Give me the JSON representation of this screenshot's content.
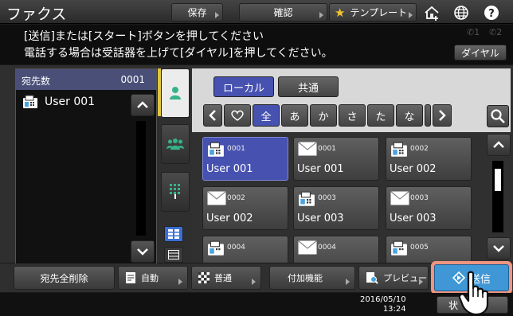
{
  "header": {
    "title": "ファクス",
    "save_label": "保存",
    "confirm_label": "確認",
    "template_label": "テンプレート"
  },
  "message": {
    "line1": "[送信]または[スタート]ボタンを押してください",
    "line2": "電話する場合は受話器を上げて[ダイヤル]を押してください。",
    "line_indicator_1": "1",
    "line_indicator_2": "2",
    "dial_label": "ダイヤル"
  },
  "recipients": {
    "header_label": "宛先数",
    "count": "0001",
    "items": [
      {
        "name": "User 001"
      }
    ]
  },
  "addressbook": {
    "local_label": "ローカル",
    "shared_label": "共通",
    "kana_tabs": [
      "全",
      "あ",
      "か",
      "さ",
      "た",
      "な"
    ],
    "active_kana": "全",
    "cards": [
      {
        "num": "0001",
        "name": "User 001",
        "type": "fax-icon",
        "selected": true
      },
      {
        "num": "0001",
        "name": "User 001",
        "type": "mail-icon",
        "selected": false
      },
      {
        "num": "0002",
        "name": "User 002",
        "type": "fax-icon",
        "selected": false
      },
      {
        "num": "0002",
        "name": "User 002",
        "type": "mail-icon",
        "selected": false
      },
      {
        "num": "0003",
        "name": "User 003",
        "type": "fax-icon",
        "selected": false
      },
      {
        "num": "0003",
        "name": "User 003",
        "type": "mail-icon",
        "selected": false
      },
      {
        "num": "0004",
        "name": "",
        "type": "fax-icon",
        "selected": false
      },
      {
        "num": "0004",
        "name": "",
        "type": "mail-icon",
        "selected": false
      },
      {
        "num": "0005",
        "name": "",
        "type": "fax-icon",
        "selected": false
      }
    ]
  },
  "functions": {
    "delete_all_label": "宛先全削除",
    "auto_label": "自動",
    "normal_label": "普通",
    "extra_label": "付加機能",
    "preview_label": "プレビュー",
    "send_label": "送信"
  },
  "status": {
    "date": "2016/05/10",
    "time": "13:24",
    "status_label": "状"
  },
  "colors": {
    "accent_blue": "#4651b0",
    "send_blue": "#3f97d6",
    "highlight": "#ef9580"
  }
}
